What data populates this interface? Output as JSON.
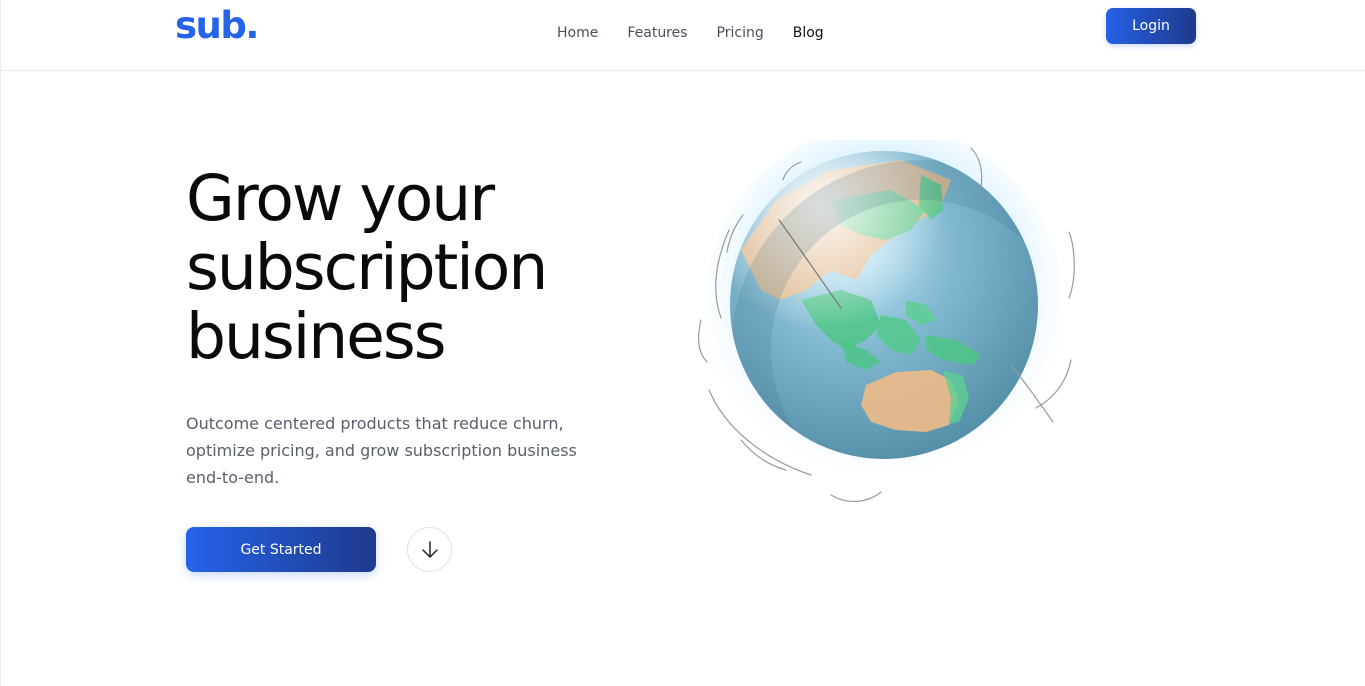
{
  "brand": {
    "logo_text": "sub.",
    "accent_color": "#2563eb",
    "accent_dark": "#1e3a8a"
  },
  "nav": {
    "links": [
      {
        "label": "Home"
      },
      {
        "label": "Features"
      },
      {
        "label": "Pricing"
      },
      {
        "label": "Blog"
      }
    ],
    "login_label": "Login"
  },
  "hero": {
    "title_lines": [
      "Grow your",
      "subscription",
      "business"
    ],
    "subtitle": "Outcome centered products that reduce churn, optimize pricing, and grow subscription business end-to-end.",
    "cta_label": "Get Started",
    "scroll_icon": "arrow-down-icon",
    "illustration": "globe-icon"
  }
}
